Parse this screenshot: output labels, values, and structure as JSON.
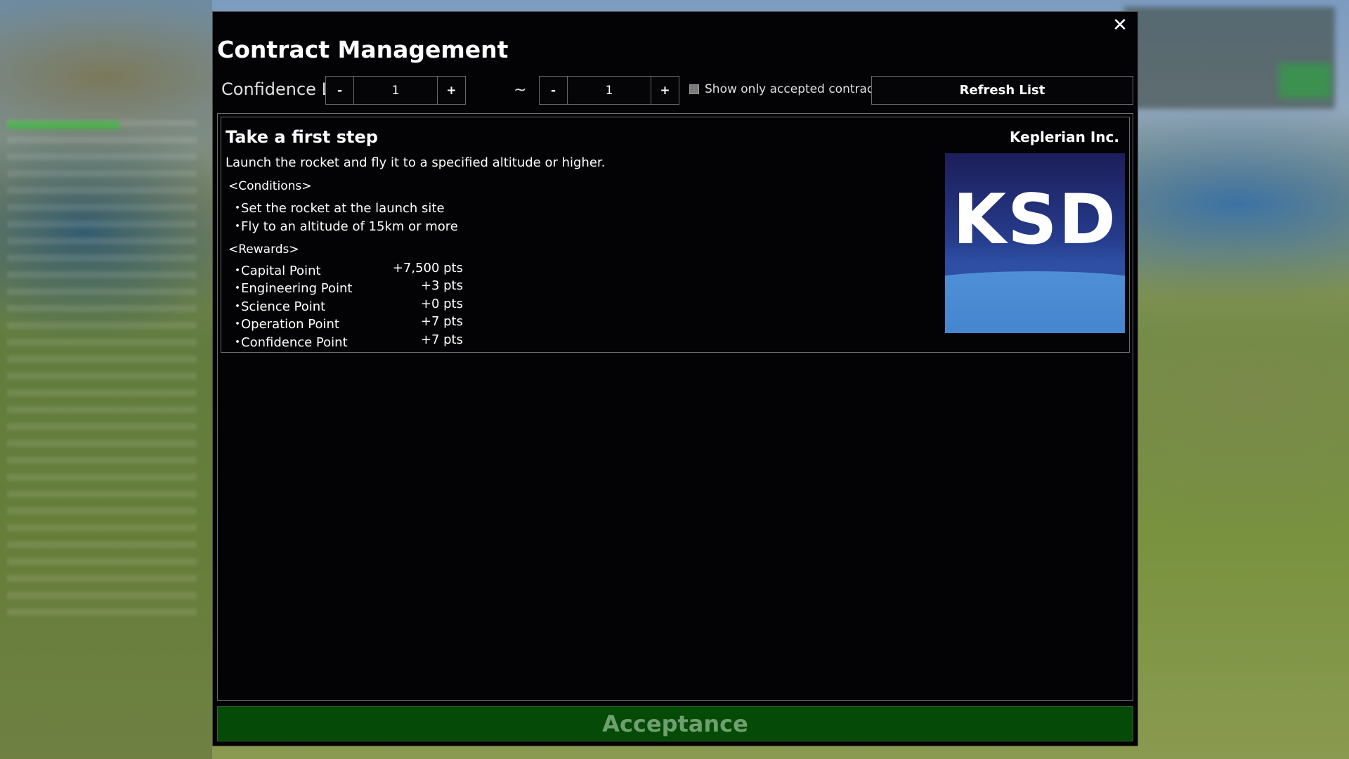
{
  "dialog": {
    "title": "Contract Management",
    "close_icon": "close-icon",
    "close_glyph": "✕"
  },
  "toolbar": {
    "confidence_label": "Confidence Level",
    "min": {
      "minus": "-",
      "value": "1",
      "plus": "+"
    },
    "tilde": "~",
    "max": {
      "minus": "-",
      "value": "1",
      "plus": "+"
    },
    "show_accepted_label": "Show only accepted contracts",
    "show_accepted_checked": false,
    "refresh_label": "Refresh List"
  },
  "contract": {
    "title": "Take a first step",
    "company": "Keplerian Inc.",
    "description": "Launch the rocket and fly it to a specified altitude or higher.",
    "conditions_header": "<Conditions>",
    "conditions": [
      "Set the rocket at the launch site",
      "Fly to an altitude of 15km or more"
    ],
    "rewards_header": "<Rewards>",
    "rewards": [
      {
        "name": "Capital Point",
        "value": "+7,500 pts"
      },
      {
        "name": "Engineering Point",
        "value": "+3 pts"
      },
      {
        "name": "Science Point",
        "value": "+0 pts"
      },
      {
        "name": "Operation Point",
        "value": "+7 pts"
      },
      {
        "name": "Confidence Point",
        "value": "+7 pts"
      }
    ],
    "bullet": "・",
    "logo_text": "KSD"
  },
  "accept_label": "Acceptance",
  "colors": {
    "dialog_bg": "#030306",
    "accept_bg": "#054a06",
    "accept_text": "#6f9f6f",
    "logo_top": "#1c1e5a",
    "logo_bottom": "#4f8fd8"
  }
}
